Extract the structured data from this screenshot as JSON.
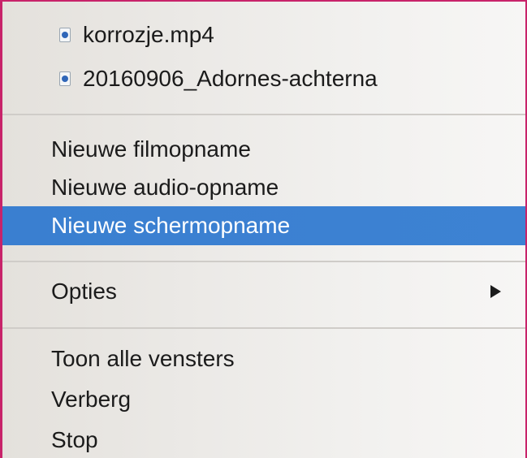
{
  "menu": {
    "recent_files": [
      {
        "label": "korrozje.mp4",
        "icon": "video-file-icon"
      },
      {
        "label": "20160906_Adornes-achterna",
        "icon": "video-file-icon"
      }
    ],
    "new_recording": [
      {
        "label": "Nieuwe filmopname",
        "highlighted": false
      },
      {
        "label": "Nieuwe audio-opname",
        "highlighted": false
      },
      {
        "label": "Nieuwe schermopname",
        "highlighted": true
      }
    ],
    "options": {
      "label": "Opties",
      "has_submenu": true
    },
    "window_actions": [
      {
        "label": "Toon alle vensters"
      },
      {
        "label": "Verberg"
      },
      {
        "label": "Stop"
      }
    ]
  },
  "colors": {
    "highlight": "#3d82d3",
    "frame_border": "#c8236a",
    "text": "#1b1b1b"
  }
}
